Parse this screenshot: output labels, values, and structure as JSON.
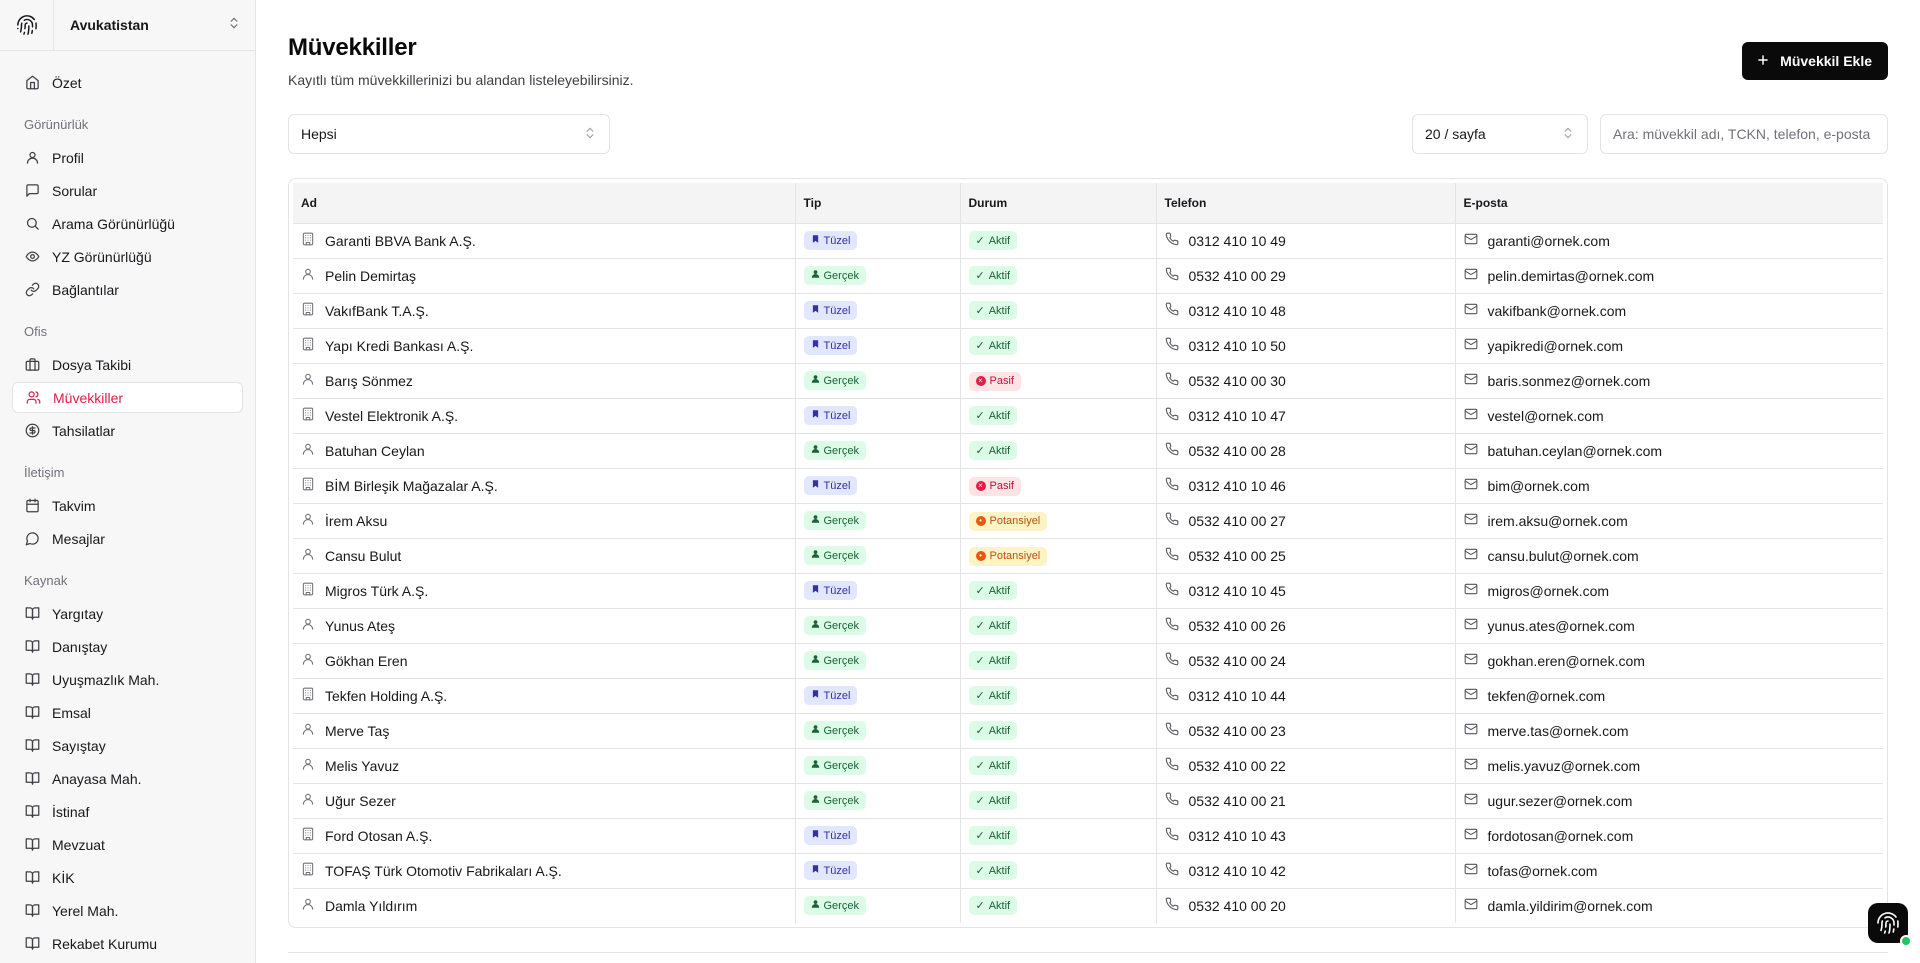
{
  "workspace": {
    "name": "Avukatistan"
  },
  "sidebar": {
    "top_items": [
      {
        "label": "Özet",
        "icon": "home-icon"
      }
    ],
    "sections": [
      {
        "title": "Görünürlük",
        "items": [
          {
            "label": "Profil",
            "icon": "user-icon"
          },
          {
            "label": "Sorular",
            "icon": "message-icon"
          },
          {
            "label": "Arama Görünürlüğü",
            "icon": "search-icon"
          },
          {
            "label": "YZ Görünürlüğü",
            "icon": "eye-icon"
          },
          {
            "label": "Bağlantılar",
            "icon": "link-icon"
          }
        ]
      },
      {
        "title": "Ofis",
        "items": [
          {
            "label": "Dosya Takibi",
            "icon": "briefcase-icon"
          },
          {
            "label": "Müvekkiller",
            "icon": "users-icon",
            "active": true
          },
          {
            "label": "Tahsilatlar",
            "icon": "dollar-icon"
          }
        ]
      },
      {
        "title": "İletişim",
        "items": [
          {
            "label": "Takvim",
            "icon": "calendar-icon"
          },
          {
            "label": "Mesajlar",
            "icon": "chat-icon"
          }
        ]
      },
      {
        "title": "Kaynak",
        "items": [
          {
            "label": "Yargıtay",
            "icon": "book-icon"
          },
          {
            "label": "Danıştay",
            "icon": "book-icon"
          },
          {
            "label": "Uyuşmazlık Mah.",
            "icon": "book-icon"
          },
          {
            "label": "Emsal",
            "icon": "book-icon"
          },
          {
            "label": "Sayıştay",
            "icon": "book-icon"
          },
          {
            "label": "Anayasa Mah.",
            "icon": "book-icon"
          },
          {
            "label": "İstinaf",
            "icon": "book-icon"
          },
          {
            "label": "Mevzuat",
            "icon": "book-icon"
          },
          {
            "label": "KİK",
            "icon": "book-icon"
          },
          {
            "label": "Yerel Mah.",
            "icon": "book-icon"
          },
          {
            "label": "Rekabet Kurumu",
            "icon": "book-icon"
          }
        ]
      }
    ]
  },
  "page": {
    "title": "Müvekkiller",
    "subtitle": "Kayıtlı tüm müvekkillerinizi bu alandan listeleyebilirsiniz.",
    "add_button": "Müvekkil Ekle"
  },
  "filters": {
    "type_value": "Hepsi",
    "page_size_value": "20 / sayfa",
    "search_placeholder": "Ara: müvekkil adı, TCKN, telefon, e-posta"
  },
  "table": {
    "headers": {
      "name": "Ad",
      "type": "Tip",
      "status": "Durum",
      "phone": "Telefon",
      "email": "E-posta"
    },
    "rows": [
      {
        "name": "Garanti BBVA Bank A.Ş.",
        "type": "Tüzel",
        "status": "Aktif",
        "phone": "0312 410 10 49",
        "email": "garanti@ornek.com"
      },
      {
        "name": "Pelin Demirtaş",
        "type": "Gerçek",
        "status": "Aktif",
        "phone": "0532 410 00 29",
        "email": "pelin.demirtas@ornek.com"
      },
      {
        "name": "VakıfBank T.A.Ş.",
        "type": "Tüzel",
        "status": "Aktif",
        "phone": "0312 410 10 48",
        "email": "vakifbank@ornek.com"
      },
      {
        "name": "Yapı Kredi Bankası A.Ş.",
        "type": "Tüzel",
        "status": "Aktif",
        "phone": "0312 410 10 50",
        "email": "yapikredi@ornek.com"
      },
      {
        "name": "Barış Sönmez",
        "type": "Gerçek",
        "status": "Pasif",
        "phone": "0532 410 00 30",
        "email": "baris.sonmez@ornek.com"
      },
      {
        "name": "Vestel Elektronik A.Ş.",
        "type": "Tüzel",
        "status": "Aktif",
        "phone": "0312 410 10 47",
        "email": "vestel@ornek.com"
      },
      {
        "name": "Batuhan Ceylan",
        "type": "Gerçek",
        "status": "Aktif",
        "phone": "0532 410 00 28",
        "email": "batuhan.ceylan@ornek.com"
      },
      {
        "name": "BİM Birleşik Mağazalar A.Ş.",
        "type": "Tüzel",
        "status": "Pasif",
        "phone": "0312 410 10 46",
        "email": "bim@ornek.com"
      },
      {
        "name": "İrem Aksu",
        "type": "Gerçek",
        "status": "Potansiyel",
        "phone": "0532 410 00 27",
        "email": "irem.aksu@ornek.com"
      },
      {
        "name": "Cansu Bulut",
        "type": "Gerçek",
        "status": "Potansiyel",
        "phone": "0532 410 00 25",
        "email": "cansu.bulut@ornek.com"
      },
      {
        "name": "Migros Türk A.Ş.",
        "type": "Tüzel",
        "status": "Aktif",
        "phone": "0312 410 10 45",
        "email": "migros@ornek.com"
      },
      {
        "name": "Yunus Ateş",
        "type": "Gerçek",
        "status": "Aktif",
        "phone": "0532 410 00 26",
        "email": "yunus.ates@ornek.com"
      },
      {
        "name": "Gökhan Eren",
        "type": "Gerçek",
        "status": "Aktif",
        "phone": "0532 410 00 24",
        "email": "gokhan.eren@ornek.com"
      },
      {
        "name": "Tekfen Holding A.Ş.",
        "type": "Tüzel",
        "status": "Aktif",
        "phone": "0312 410 10 44",
        "email": "tekfen@ornek.com"
      },
      {
        "name": "Merve Taş",
        "type": "Gerçek",
        "status": "Aktif",
        "phone": "0532 410 00 23",
        "email": "merve.tas@ornek.com"
      },
      {
        "name": "Melis Yavuz",
        "type": "Gerçek",
        "status": "Aktif",
        "phone": "0532 410 00 22",
        "email": "melis.yavuz@ornek.com"
      },
      {
        "name": "Uğur Sezer",
        "type": "Gerçek",
        "status": "Aktif",
        "phone": "0532 410 00 21",
        "email": "ugur.sezer@ornek.com"
      },
      {
        "name": "Ford Otosan A.Ş.",
        "type": "Tüzel",
        "status": "Aktif",
        "phone": "0312 410 10 43",
        "email": "fordotosan@ornek.com"
      },
      {
        "name": "TOFAŞ Türk Otomotiv Fabrikaları A.Ş.",
        "type": "Tüzel",
        "status": "Aktif",
        "phone": "0312 410 10 42",
        "email": "tofas@ornek.com"
      },
      {
        "name": "Damla Yıldırım",
        "type": "Gerçek",
        "status": "Aktif",
        "phone": "0532 410 00 20",
        "email": "damla.yildirim@ornek.com"
      }
    ]
  },
  "colors": {
    "accent": "#e11d48",
    "primary_button": "#0a0a0a",
    "online": "#22c55e"
  }
}
